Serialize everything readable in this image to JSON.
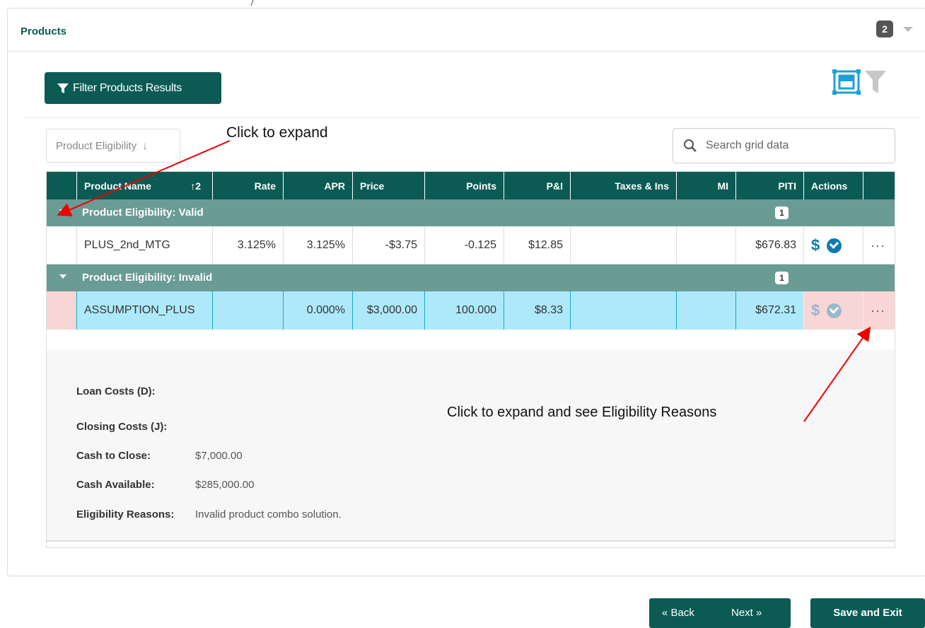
{
  "panel": {
    "title": "Products",
    "count": "2"
  },
  "toolbar": {
    "filter_label": "Filter Products Results"
  },
  "group_by": {
    "label": "Product Eligibility",
    "arrow": "↓"
  },
  "search": {
    "placeholder": "Search grid data"
  },
  "annotations": {
    "expand_group": "Click to expand",
    "expand_row": "Click to expand and see Eligibility Reasons"
  },
  "grid": {
    "columns": [
      {
        "label": "Product Name",
        "sort": "↑2"
      },
      {
        "label": "Rate"
      },
      {
        "label": "APR"
      },
      {
        "label": "Price"
      },
      {
        "label": "Points"
      },
      {
        "label": "P&I"
      },
      {
        "label": "Taxes & Ins"
      },
      {
        "label": "MI"
      },
      {
        "label": "PITI"
      },
      {
        "label": "Actions"
      }
    ],
    "groups": [
      {
        "label": "Product Eligibility: Valid",
        "count": "1",
        "rows": [
          {
            "name": "PLUS_2nd_MTG",
            "rate": "3.125%",
            "apr": "3.125%",
            "price": "-$3.75",
            "points": "-0.125",
            "pi": "$12.85",
            "taxes": "",
            "mi": "",
            "piti": "$676.83",
            "action_dollar": "$",
            "more": "···"
          }
        ]
      },
      {
        "label": "Product Eligibility: Invalid",
        "count": "1",
        "rows": [
          {
            "name": "ASSUMPTION_PLUS",
            "rate": "",
            "apr": "0.000%",
            "price": "$3,000.00",
            "points": "100.000",
            "pi": "$8.33",
            "taxes": "",
            "mi": "",
            "piti": "$672.31",
            "action_dollar": "$",
            "more": "···"
          }
        ]
      }
    ],
    "detail": {
      "loan_costs_label": "Loan Costs (D):",
      "closing_costs_label": "Closing Costs (J):",
      "cash_to_close_label": "Cash to Close:",
      "cash_to_close_value": "$7,000.00",
      "cash_available_label": "Cash Available:",
      "cash_available_value": "$285,000.00",
      "eligibility_label": "Eligibility Reasons:",
      "eligibility_value": "Invalid product combo solution."
    }
  },
  "footer": {
    "back_label": "« Back",
    "next_label": "Next »",
    "save_exit_label": "Save and Exit"
  },
  "colors": {
    "primary": "#0b5b54",
    "group": "#6a9b95",
    "selected_row": "#aee9fb",
    "invalid_row": "#f9d6d6",
    "action_blue": "#0f7ab1"
  }
}
